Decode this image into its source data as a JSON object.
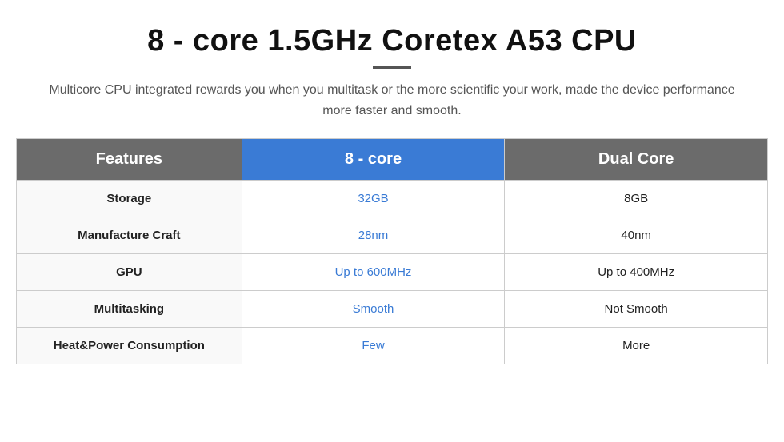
{
  "header": {
    "title": "8 - core 1.5GHz Coretex A53 CPU",
    "divider": true,
    "subtitle": "Multicore CPU integrated rewards you when you multitask or the more scientific your work, made the device performance more faster and smooth."
  },
  "table": {
    "columns": [
      {
        "id": "features",
        "label": "Features"
      },
      {
        "id": "8core",
        "label": "8 - core"
      },
      {
        "id": "dualcore",
        "label": "Dual Core"
      }
    ],
    "rows": [
      {
        "feature": "Storage",
        "value_8core": "32GB",
        "value_dual": "8GB"
      },
      {
        "feature": "Manufacture Craft",
        "value_8core": "28nm",
        "value_dual": "40nm"
      },
      {
        "feature": "GPU",
        "value_8core": "Up to 600MHz",
        "value_dual": "Up to 400MHz"
      },
      {
        "feature": "Multitasking",
        "value_8core": "Smooth",
        "value_dual": "Not Smooth"
      },
      {
        "feature": "Heat&Power Consumption",
        "value_8core": "Few",
        "value_dual": "More"
      }
    ]
  }
}
